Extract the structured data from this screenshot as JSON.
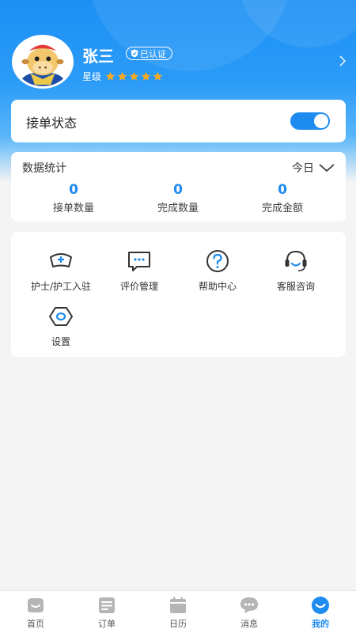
{
  "profile": {
    "name": "张三",
    "verified_label": "已认证",
    "level_label": "星级",
    "stars": 5
  },
  "order_status": {
    "label": "接单状态",
    "enabled": true
  },
  "stats": {
    "title": "数据统计",
    "period": "今日",
    "items": [
      {
        "value": "0",
        "label": "接单数量"
      },
      {
        "value": "0",
        "label": "完成数量"
      },
      {
        "value": "0",
        "label": "完成金额"
      }
    ]
  },
  "menu": [
    {
      "label": "护士/护工入驻",
      "icon": "nurse-cap-icon"
    },
    {
      "label": "评价管理",
      "icon": "comment-icon"
    },
    {
      "label": "帮助中心",
      "icon": "help-icon"
    },
    {
      "label": "客服咨询",
      "icon": "headset-icon"
    },
    {
      "label": "设置",
      "icon": "settings-icon"
    }
  ],
  "tabs": [
    {
      "label": "首页",
      "icon": "home-icon"
    },
    {
      "label": "订单",
      "icon": "order-icon"
    },
    {
      "label": "日历",
      "icon": "calendar-icon"
    },
    {
      "label": "消息",
      "icon": "message-icon"
    },
    {
      "label": "我的",
      "icon": "profile-icon",
      "active": true
    }
  ],
  "colors": {
    "accent": "#1e8bf0",
    "star": "#f7a823"
  }
}
